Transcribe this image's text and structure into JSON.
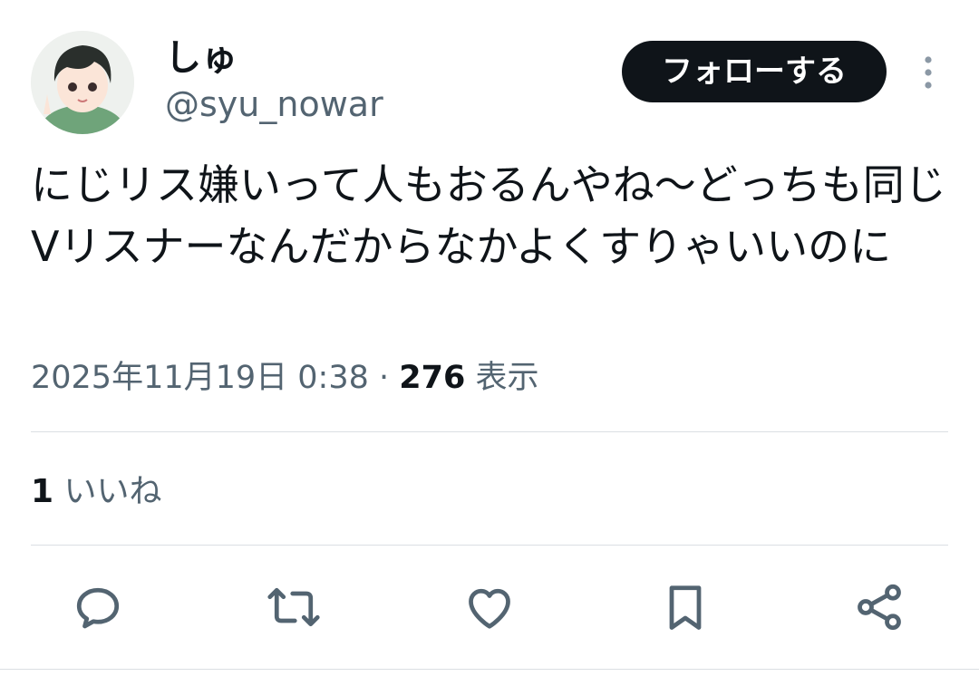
{
  "user": {
    "display_name": "しゅ",
    "handle": "@syu_nowar",
    "avatar_icon": "avatar-illustration"
  },
  "follow_button_label": "フォローする",
  "tweet": {
    "text": "にじリス嫌いって人もおるんやね〜どっちも同じVリスナーなんだからなかよくすりゃいいのに",
    "timestamp": "2025年11月19日 0:38",
    "separator": " · ",
    "views_count": "276",
    "views_label": " 表示"
  },
  "engagement": {
    "likes_count": "1",
    "likes_label": " いいね"
  },
  "actions": [
    {
      "name": "reply",
      "icon": "reply-icon"
    },
    {
      "name": "retweet",
      "icon": "retweet-icon"
    },
    {
      "name": "like",
      "icon": "heart-icon"
    },
    {
      "name": "bookmark",
      "icon": "bookmark-icon"
    },
    {
      "name": "share",
      "icon": "share-icon"
    }
  ],
  "colors": {
    "text_primary": "#0f1419",
    "text_secondary": "#536471",
    "follow_bg": "#0f1419",
    "divider": "#dbdfe3"
  }
}
